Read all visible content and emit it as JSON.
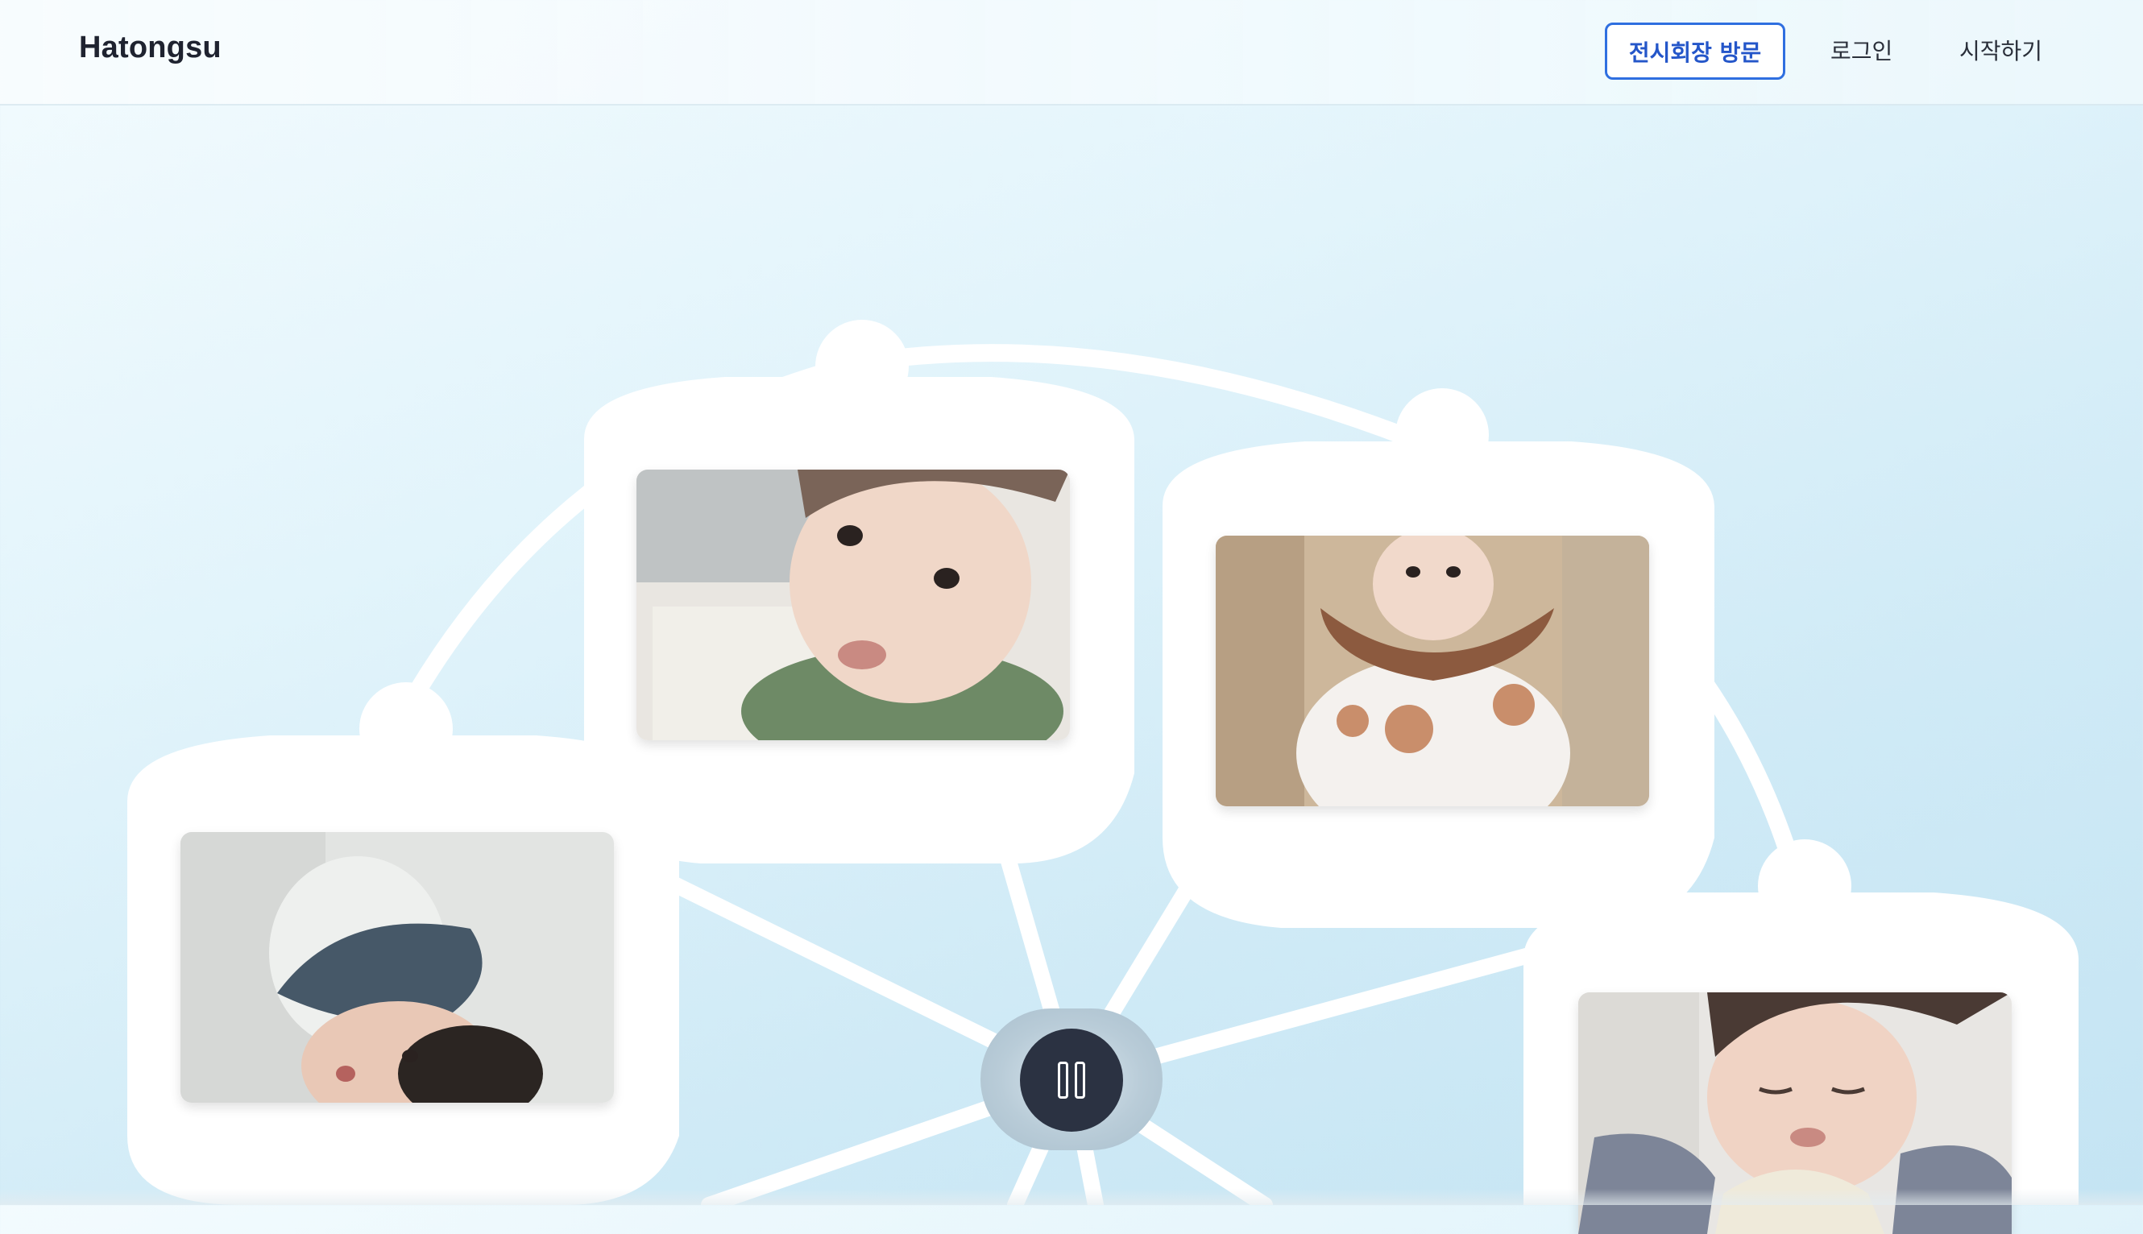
{
  "header": {
    "logo": "Hatongsu",
    "visit_button": "전시회장 방문",
    "login": "로그인",
    "start": "시작하기"
  },
  "gallery": {
    "photos": [
      {
        "name": "baby-photo-green-shirt",
        "description_icon": "photo-icon"
      },
      {
        "name": "baby-photo-brown-bib",
        "description_icon": "photo-icon"
      },
      {
        "name": "baby-photo-lying-blanket",
        "description_icon": "photo-icon"
      },
      {
        "name": "baby-photo-sleeping",
        "description_icon": "photo-icon"
      }
    ]
  },
  "controls": {
    "pause_icon": "pause-icon"
  },
  "colors": {
    "accent": "#2f6fe0",
    "hub_button": "#2b3242",
    "background": "#d8f0f9"
  }
}
